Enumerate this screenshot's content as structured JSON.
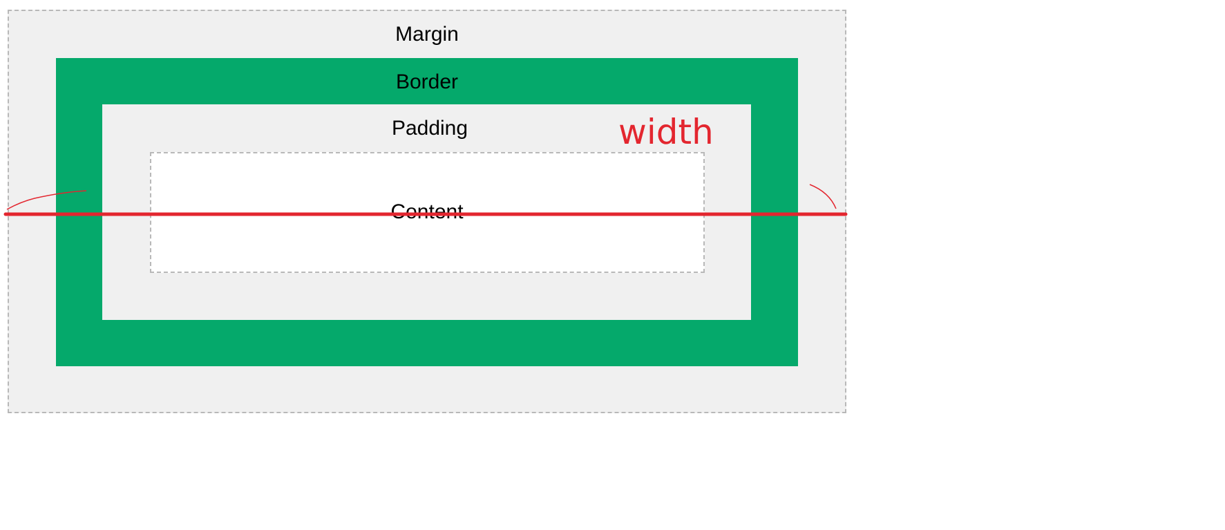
{
  "diagram": {
    "margin_label": "Margin",
    "border_label": "Border",
    "padding_label": "Padding",
    "content_label": "Content"
  },
  "annotation": {
    "width_label": "width"
  },
  "colors": {
    "margin_fill": "#f0f0f0",
    "border_fill": "#05a96b",
    "padding_fill": "#f0f0f0",
    "content_fill": "#ffffff",
    "dashed_outline": "#b8b8b8",
    "annotation_red": "#e3262f"
  }
}
